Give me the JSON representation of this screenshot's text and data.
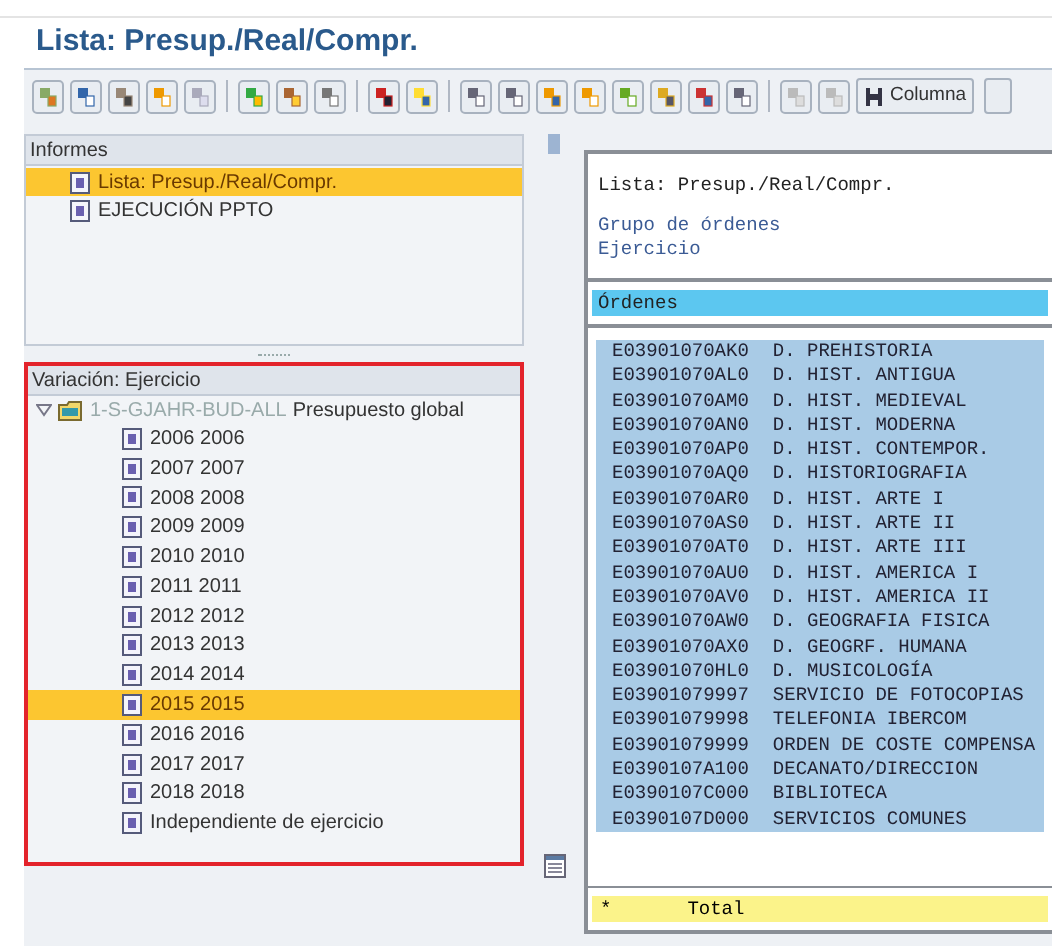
{
  "window": {
    "title": "Lista: Presup./Real/Compr."
  },
  "toolbar": {
    "buttons": [
      {
        "label": "Columna"
      }
    ]
  },
  "reports_panel": {
    "title": "Informes",
    "items": [
      {
        "label": "Lista: Presup./Real/Compr.",
        "selected": true
      },
      {
        "label": "EJECUCIÓN PPTO",
        "selected": false
      }
    ]
  },
  "variation_panel": {
    "title": "Variación: Ejercicio",
    "tree": [
      {
        "code": "1-S-GJAHR-BUD-ALL",
        "label": "Presupuesto global",
        "expanded": true,
        "children": [
          {
            "label": "2006 2006",
            "selected": false
          },
          {
            "label": "2007 2007",
            "selected": false
          },
          {
            "label": "2008 2008",
            "selected": false
          },
          {
            "label": "2009 2009",
            "selected": false
          },
          {
            "label": "2010 2010",
            "selected": false
          },
          {
            "label": "2011 2011",
            "selected": false
          },
          {
            "label": "2012 2012",
            "selected": false
          },
          {
            "label": "2013 2013",
            "selected": false
          },
          {
            "label": "2014 2014",
            "selected": false
          },
          {
            "label": "2015 2015",
            "selected": true
          },
          {
            "label": "2016 2016",
            "selected": false
          },
          {
            "label": "2017 2017",
            "selected": false
          },
          {
            "label": "2018 2018",
            "selected": false
          },
          {
            "label": "Independiente de ejercicio",
            "selected": false
          }
        ]
      }
    ]
  },
  "report": {
    "title": "Lista: Presup./Real/Compr.",
    "header_lines": [
      "Grupo de órdenes",
      "Ejercicio"
    ],
    "column_header": "Órdenes",
    "rows": [
      {
        "order": "E03901070AK0",
        "description": "D. PREHISTORIA"
      },
      {
        "order": "E03901070AL0",
        "description": "D. HIST. ANTIGUA"
      },
      {
        "order": "E03901070AM0",
        "description": "D. HIST. MEDIEVAL"
      },
      {
        "order": "E03901070AN0",
        "description": "D. HIST. MODERNA"
      },
      {
        "order": "E03901070AP0",
        "description": "D. HIST. CONTEMPOR."
      },
      {
        "order": "E03901070AQ0",
        "description": "D. HISTORIOGRAFIA"
      },
      {
        "order": "E03901070AR0",
        "description": "D. HIST. ARTE I"
      },
      {
        "order": "E03901070AS0",
        "description": "D. HIST. ARTE II"
      },
      {
        "order": "E03901070AT0",
        "description": "D. HIST. ARTE III"
      },
      {
        "order": "E03901070AU0",
        "description": "D. HIST. AMERICA I"
      },
      {
        "order": "E03901070AV0",
        "description": "D. HIST. AMERICA II"
      },
      {
        "order": "E03901070AW0",
        "description": "D. GEOGRAFIA FISICA"
      },
      {
        "order": "E03901070AX0",
        "description": "D. GEOGRF. HUMANA"
      },
      {
        "order": "E03901070HL0",
        "description": "D. MUSICOLOGÍA"
      },
      {
        "order": "E03901079997",
        "description": "SERVICIO DE FOTOCOPIAS"
      },
      {
        "order": "E03901079998",
        "description": "TELEFONIA IBERCOM"
      },
      {
        "order": "E03901079999",
        "description": "ORDEN DE COSTE COMPENSA"
      },
      {
        "order": "E0390107A100",
        "description": "DECANATO/DIRECCION"
      },
      {
        "order": "E0390107C000",
        "description": "BIBLIOTECA"
      },
      {
        "order": "E0390107D000",
        "description": "SERVICIOS COMUNES"
      }
    ],
    "total": {
      "marker": "*",
      "label": "Total"
    }
  }
}
